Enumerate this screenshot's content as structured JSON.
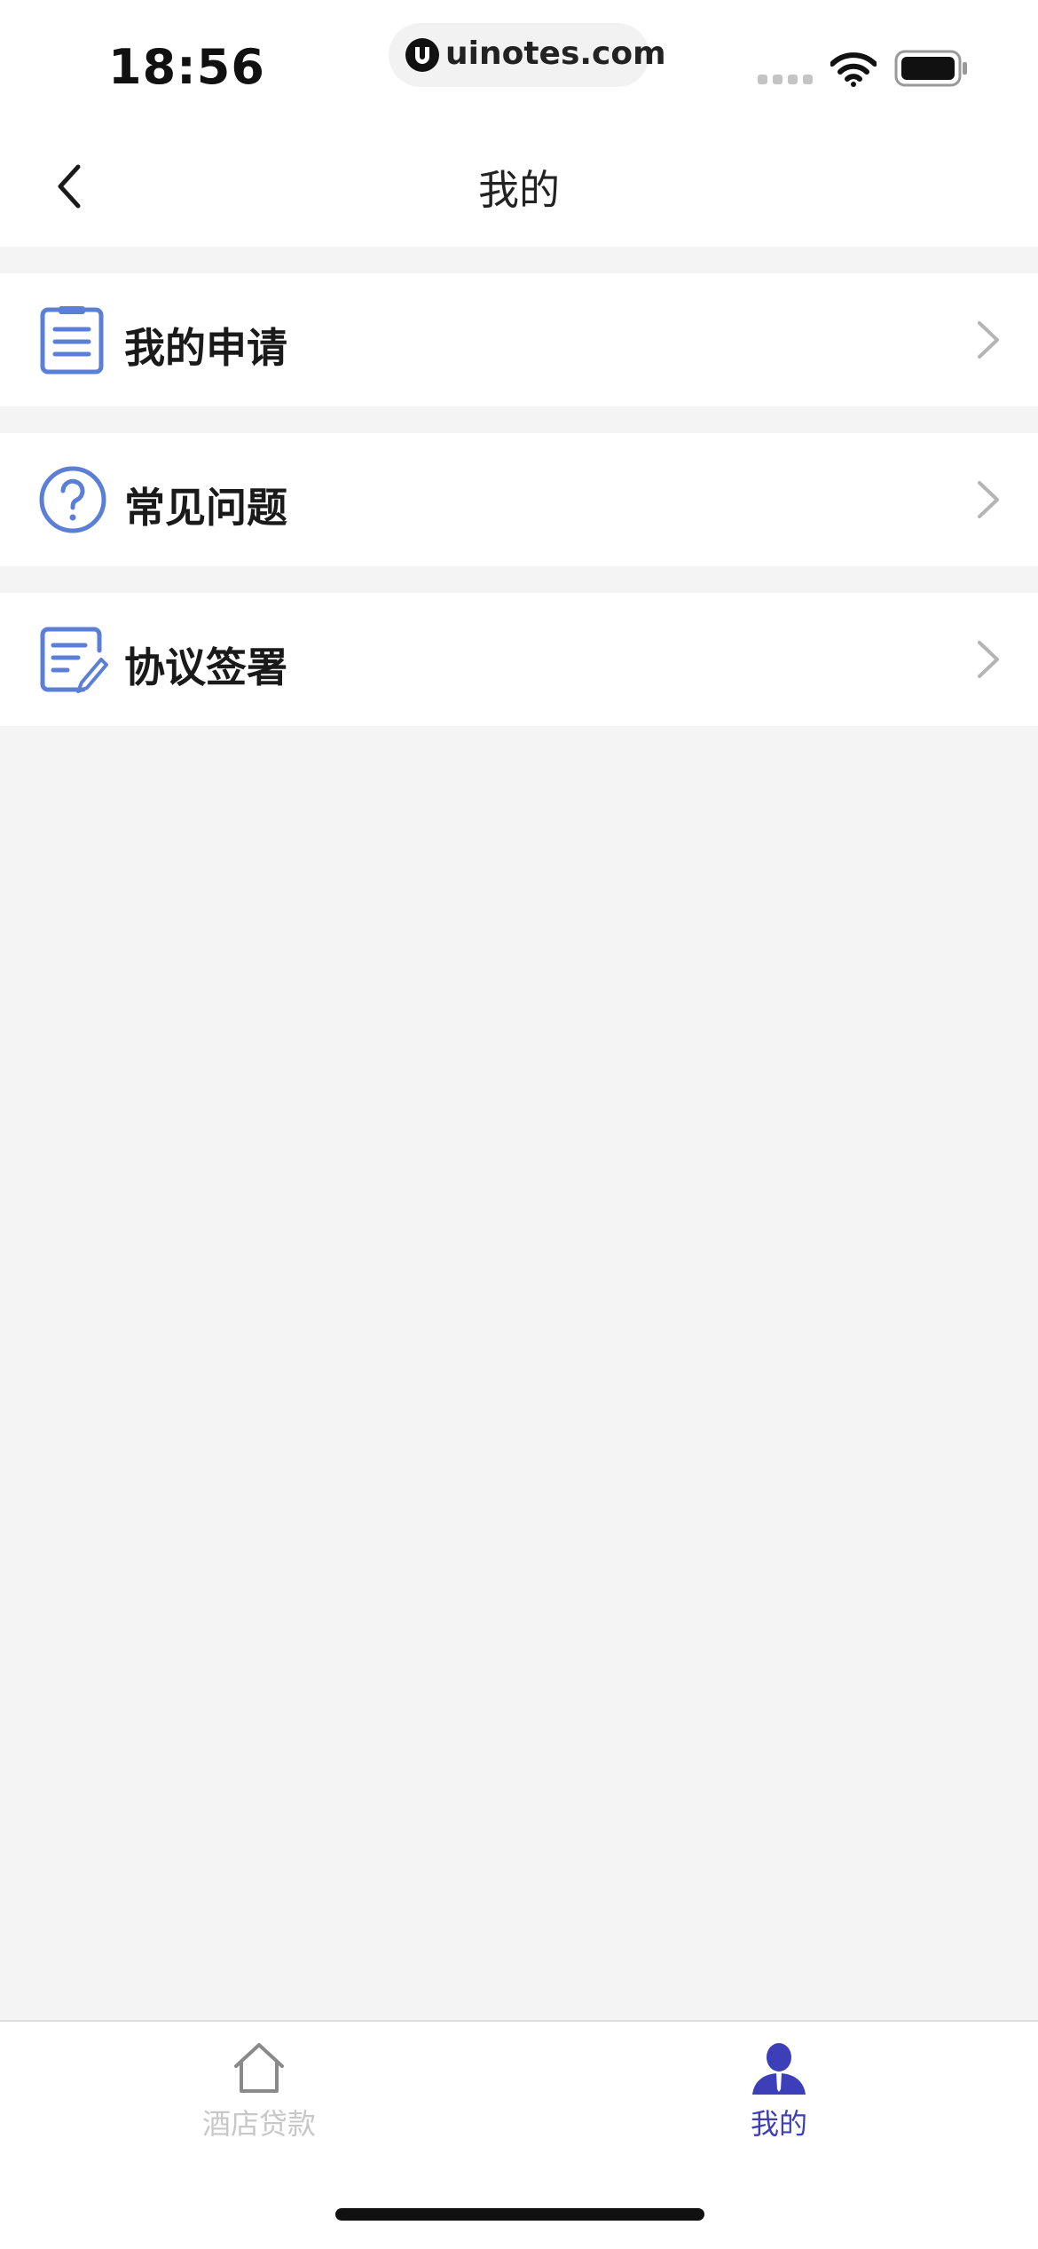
{
  "status_bar": {
    "time": "18:56",
    "url": "uinotes.com"
  },
  "nav": {
    "title": "我的"
  },
  "menu": {
    "items": [
      {
        "label": "我的申请",
        "icon": "document-list-icon"
      },
      {
        "label": "常见问题",
        "icon": "question-circle-icon"
      },
      {
        "label": "协议签署",
        "icon": "document-sign-icon"
      }
    ]
  },
  "tabs": [
    {
      "label": "酒店贷款",
      "icon": "home-icon",
      "active": false
    },
    {
      "label": "我的",
      "icon": "person-icon",
      "active": true
    }
  ],
  "colors": {
    "accent": "#3d3fb8",
    "icon_blue": "#5b7fd6",
    "inactive": "#c8c8c8",
    "background": "#f4f4f4"
  }
}
